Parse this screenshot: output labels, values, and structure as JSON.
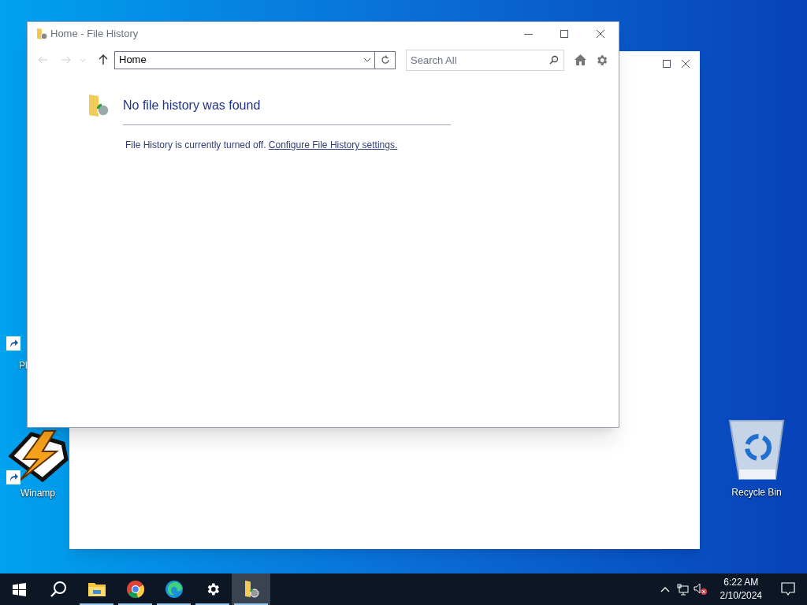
{
  "desktop_icons": [
    {
      "kind": "shortcut",
      "label": "Pl"
    },
    {
      "kind": "winamp",
      "label": "Winamp"
    },
    {
      "kind": "recycle",
      "label": "Recycle Bin"
    }
  ],
  "window": {
    "title": "Home - File History",
    "address": "Home",
    "search": {
      "placeholder": "Search All"
    },
    "heading": "No file history was found",
    "message": "File History is currently turned off.",
    "link": "Configure File History settings."
  },
  "taskbar": {
    "items": [
      {
        "kind": "start",
        "running": false,
        "selected": false
      },
      {
        "kind": "search",
        "running": false,
        "selected": false
      },
      {
        "kind": "explorer",
        "running": true,
        "selected": false
      },
      {
        "kind": "chrome",
        "running": true,
        "selected": false
      },
      {
        "kind": "edge",
        "running": true,
        "selected": false
      },
      {
        "kind": "settings",
        "running": true,
        "selected": false
      },
      {
        "kind": "filehistory",
        "running": true,
        "selected": true
      }
    ],
    "time": "6:22 AM",
    "date": "2/10/2024"
  }
}
